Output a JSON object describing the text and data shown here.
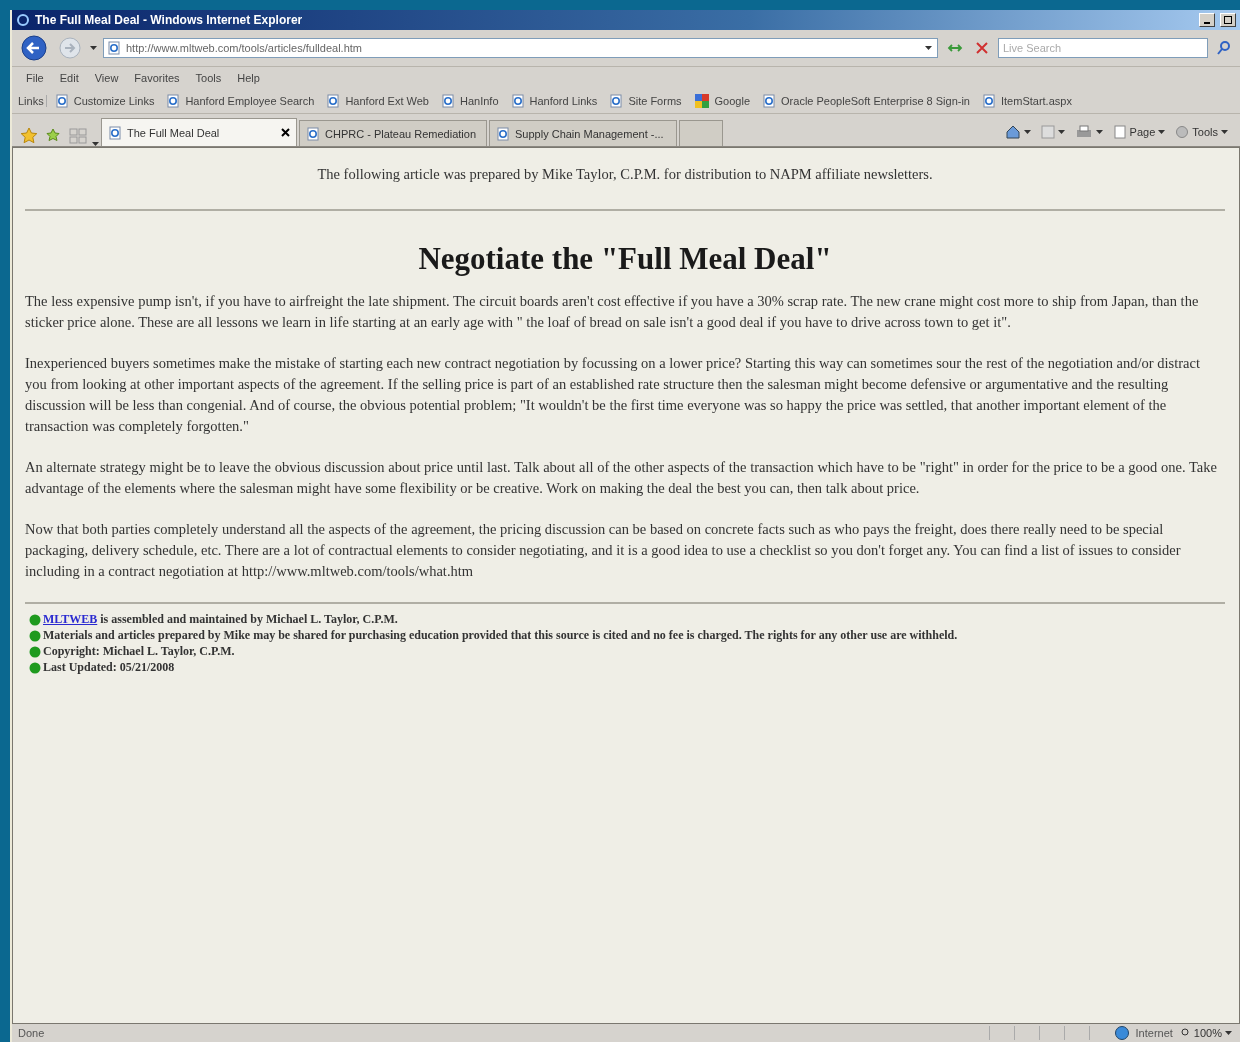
{
  "window": {
    "title": "The Full Meal Deal - Windows Internet Explorer"
  },
  "address_bar": {
    "value": "http://www.mltweb.com/tools/articles/fulldeal.htm",
    "search_placeholder": "Live Search"
  },
  "menu": [
    "File",
    "Edit",
    "View",
    "Favorites",
    "Tools",
    "Help"
  ],
  "links_bar": {
    "label": "Links",
    "items": [
      {
        "label": "Customize Links",
        "kind": "page"
      },
      {
        "label": "Hanford Employee Search",
        "kind": "page"
      },
      {
        "label": "Hanford Ext Web",
        "kind": "page"
      },
      {
        "label": "HanInfo",
        "kind": "page"
      },
      {
        "label": "Hanford Links",
        "kind": "page"
      },
      {
        "label": "Site Forms",
        "kind": "page"
      },
      {
        "label": "Google",
        "kind": "google"
      },
      {
        "label": "Oracle  PeopleSoft Enterprise 8 Sign-in",
        "kind": "page"
      },
      {
        "label": "ItemStart.aspx",
        "kind": "page"
      }
    ]
  },
  "tabs": [
    {
      "label": "The Full Meal Deal",
      "selected": true
    },
    {
      "label": "CHPRC - Plateau Remediation",
      "selected": false
    },
    {
      "label": "Supply Chain Management -...",
      "selected": false
    }
  ],
  "command_bar": [
    "Page",
    "Tools"
  ],
  "page": {
    "intro": "The following article was prepared by Mike Taylor, C.P.M. for distribution to NAPM affiliate newsletters.",
    "heading": "Negotiate the \"Full Meal Deal\"",
    "paragraphs": [
      "The less expensive pump isn't, if you have to airfreight the late shipment. The circuit boards aren't cost effective if you have a 30% scrap rate. The new crane might cost more to ship from Japan, than the sticker price alone. These are all lessons we learn in life starting at an early age with \" the loaf of bread on sale isn't a good deal if you have to drive across town to get it\".",
      "Inexperienced buyers sometimes make the mistake of starting each new contract negotiation by focussing on a lower price? Starting this way can sometimes sour the rest of the negotiation and/or distract you from looking at other important aspects of the agreement. If the selling price is part of an established rate structure then the salesman might become defensive or argumentative and the resulting discussion will be less than congenial. And of course, the obvious potential problem; \"It wouldn't be the first time everyone was so happy the price was settled, that another important element of the transaction was completely forgotten.\"",
      "An alternate strategy might be to leave the obvious discussion about price until last. Talk about all of the other aspects of the transaction which have to be \"right\" in order for the price to be a good one. Take advantage of the elements where the salesman might have some flexibility or be creative. Work on making the deal the best you can, then talk about price.",
      "Now that both parties completely understand all the aspects of the agreement, the pricing discussion can be based on concrete facts such as who pays the freight, does there really need to be special packaging, delivery schedule, etc. There are a lot of contractual elements to consider negotiating, and it is a good idea to use a checklist so you don't forget any. You can find a list of issues to consider including in a contract negotiation at http://www.mltweb.com/tools/what.htm"
    ],
    "footer": [
      {
        "link": "MLTWEB",
        "text": " is assembled and maintained by Michael L. Taylor, C.P.M."
      },
      {
        "text": "Materials and articles prepared by Mike may be shared for purchasing education provided that this source is cited and no fee is charged. The rights for any other use are withheld."
      },
      {
        "text": "Copyright:  Michael L. Taylor, C.P.M."
      },
      {
        "text": "Last Updated: 05/21/2008"
      }
    ]
  },
  "status_bar": {
    "text": "Done",
    "zone": "Internet",
    "zoom": "100%"
  }
}
